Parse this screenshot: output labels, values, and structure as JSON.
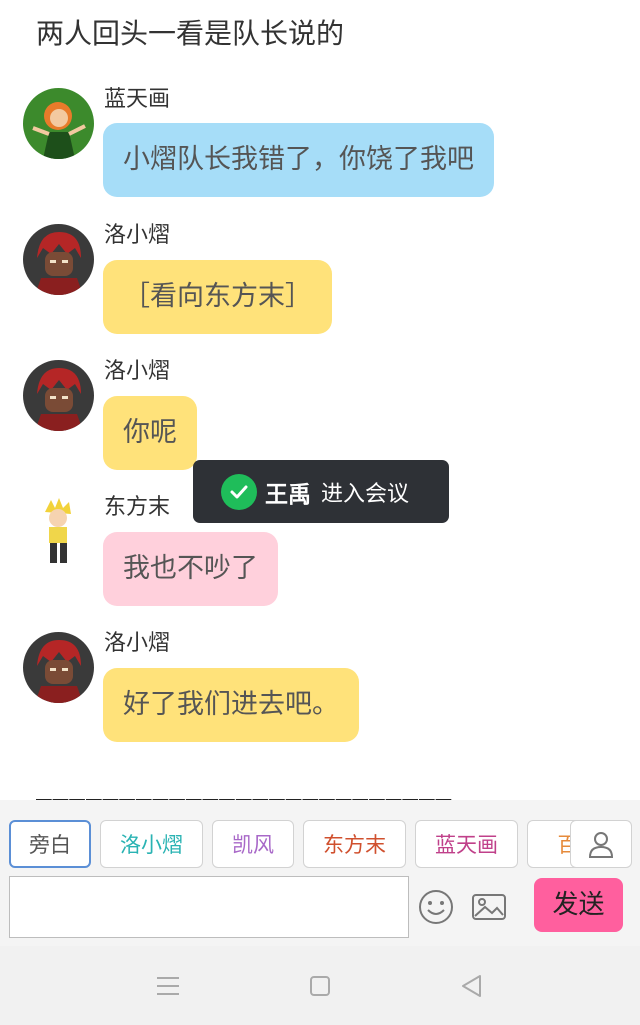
{
  "narration": "两人回头一看是队长说的",
  "messages": [
    {
      "sender": "蓝天画",
      "text": "小熠队长我错了，你饶了我吧",
      "avatar": "green-character-avatar"
    },
    {
      "sender": "洛小熠",
      "text": "［看向东方末］",
      "avatar": "red-hair-boy-avatar"
    },
    {
      "sender": "洛小熠",
      "text": "你呢",
      "avatar": "red-hair-boy-avatar"
    },
    {
      "sender": "东方末",
      "text": "我也不吵了",
      "avatar": "blonde-character-avatar"
    },
    {
      "sender": "洛小熠",
      "text": "好了我们进去吧。",
      "avatar": "red-hair-boy-avatar"
    }
  ],
  "toast": {
    "name": "王禹",
    "action": "进入会议",
    "icon": "check-circle-icon",
    "icon_color": "#1fbd5a"
  },
  "divider": "_________________________",
  "characters": [
    {
      "label": "旁白",
      "color": "#555555",
      "selected": true
    },
    {
      "label": "洛小熠",
      "color": "#2ab3b3"
    },
    {
      "label": "凯风",
      "color": "#a868c8"
    },
    {
      "label": "东方末",
      "color": "#d0502e"
    },
    {
      "label": "蓝天画",
      "color": "#c0408a"
    },
    {
      "label": "百",
      "color": "#e68a3a"
    }
  ],
  "composer": {
    "input_value": "",
    "send_label": "发送",
    "send_color": "#ff5f9e"
  },
  "icons": {
    "user": "user-icon",
    "emoji": "smiley-icon",
    "image": "image-icon"
  },
  "colors": {
    "bubble_blue": "#a6ddf8",
    "bubble_yellow": "#ffe27a",
    "bubble_pink": "#ffd0dc"
  }
}
